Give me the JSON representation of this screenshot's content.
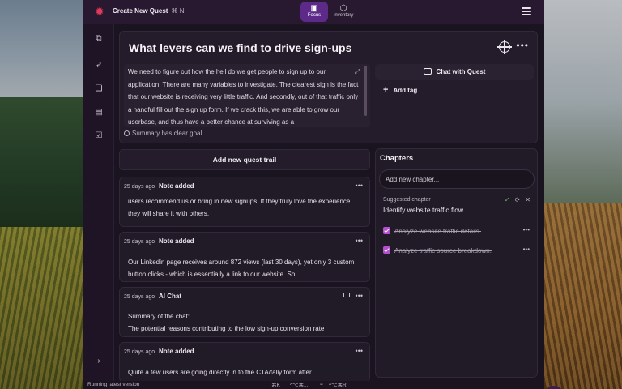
{
  "header": {
    "create_label": "Create New Quest",
    "create_shortcut": "⌘ N",
    "modes": [
      {
        "label": "Focus",
        "icon": "focus-icon",
        "active": true
      },
      {
        "label": "Inventory",
        "icon": "cube-icon",
        "active": false
      }
    ]
  },
  "sidebar": {
    "icons": [
      "quests-icon",
      "rocket-icon",
      "chat-icon",
      "clipboard-icon",
      "checkbox-icon",
      "chevron-right-icon"
    ]
  },
  "quest": {
    "title": "What levers can we find to drive sign-ups",
    "summary": "We need to figure out how the hell do we get people to sign up to our application. There are many variables to investigate. The clearest sign is the fact that our website is receiving very little traffic. And secondly, out of that traffic only a handful fill out the sign up form. If we crack this, we are able to grow our userbase, and thus have a better chance at surviving as a",
    "goal_status": "Summary has clear goal",
    "chat_button": "Chat with Quest",
    "add_tag": "Add tag"
  },
  "trail": {
    "add_button": "Add new quest trail",
    "entries": [
      {
        "age": "25 days ago",
        "type": "Note added",
        "text": "users recommend us or bring in new signups. If they truly love the experience, they will share it with others."
      },
      {
        "age": "25 days ago",
        "type": "Note added",
        "text": "Our Linkedin page receives around 872 views (last 30 days), yet only 3 custom button clicks - which is essentially a link to our website. So"
      },
      {
        "age": "25 days ago",
        "type": "AI Chat",
        "text": "Summary of the chat:\nThe potential reasons contributing to the low sign-up conversion rate"
      },
      {
        "age": "25 days ago",
        "type": "Note added",
        "text": "Quite a few users are going directly in to the CTA/tally form after"
      }
    ]
  },
  "chapters": {
    "title": "Chapters",
    "input_placeholder": "Add new chapter...",
    "suggested_label": "Suggested chapter",
    "suggested_text": "Identify website traffic flow.",
    "items": [
      {
        "label": "Analyze website traffic details.",
        "done": true
      },
      {
        "label": "Analyze traffic source breakdown.",
        "done": true
      }
    ]
  },
  "statusbar": {
    "status": "Running latest version",
    "shortcut1": "⌘K",
    "shortcut2": "^⌥⌘...",
    "shortcut3": "≈",
    "shortcut4": "^⌥⌘R"
  },
  "colors": {
    "accent": "#5d2a8a",
    "logo": "#e0395a",
    "checkbox": "#b44fd0"
  }
}
